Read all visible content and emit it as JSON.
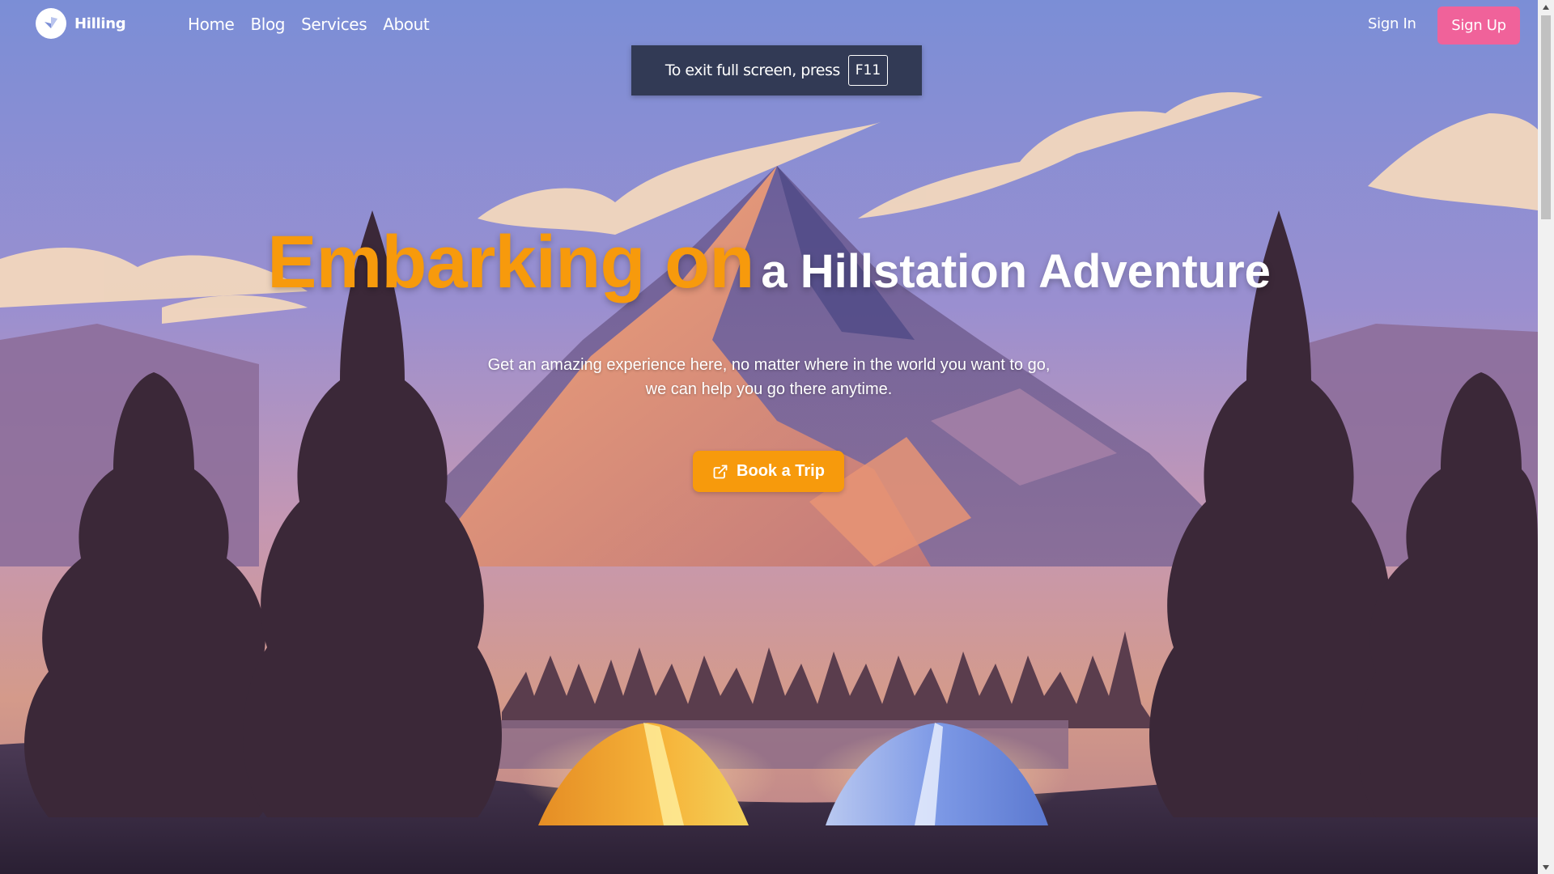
{
  "brand": {
    "name": "Hilling"
  },
  "nav": {
    "links": [
      "Home",
      "Blog",
      "Services",
      "About"
    ],
    "sign_in": "Sign In",
    "sign_up": "Sign Up"
  },
  "fullscreen_notice": {
    "text": "To exit full screen, press",
    "key": "F11"
  },
  "hero": {
    "title_accent": "Embarking on",
    "title_rest": "a Hillstation Adventure",
    "subtitle_line1": "Get an amazing experience here, no matter where in the world you want to go,",
    "subtitle_line2": "we can help you go there anytime.",
    "cta_label": "Book a Trip",
    "cta_icon": "external-link-icon"
  },
  "colors": {
    "accent": "#f79a0c",
    "signup": "#f0629a",
    "notice_bg": "#323a55",
    "sky_top": "#7b8ed6",
    "sky_mid": "#b88fb8"
  }
}
